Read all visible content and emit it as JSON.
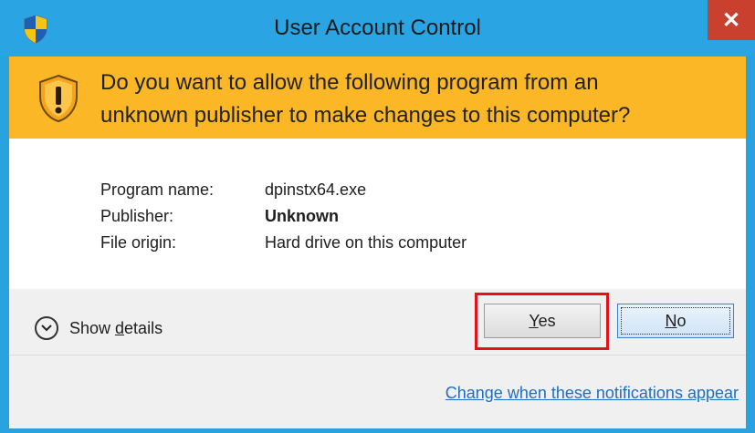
{
  "window": {
    "title": "User Account Control",
    "close_glyph": "✕",
    "title_icon": "uac-shield-icon"
  },
  "banner": {
    "line1": "Do you want to allow the following program from an",
    "line2": "unknown publisher to make changes to this computer?",
    "icon": "warning-shield-icon",
    "color": "#fbb726"
  },
  "info": {
    "program_name_label": "Program name:",
    "program_name_value": "dpinstx64.exe",
    "publisher_label": "Publisher:",
    "publisher_value": "Unknown",
    "file_origin_label": "File origin:",
    "file_origin_value": "Hard drive on this computer"
  },
  "controls": {
    "show_details_prefix": "Show ",
    "show_details_access": "d",
    "show_details_rest": "etails",
    "yes_access": "Y",
    "yes_rest": "es",
    "no_access": "N",
    "no_rest": "o",
    "notifications_link": "Change when these notifications appear"
  },
  "colors": {
    "titlebar": "#2aa4e2",
    "close_button": "#c9402f",
    "highlight_border": "#e0121c",
    "link": "#1e6fc0"
  }
}
